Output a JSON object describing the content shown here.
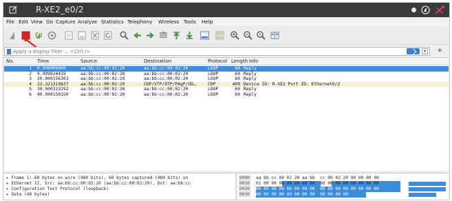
{
  "window": {
    "title": "R-XE2_e0/2"
  },
  "menu": [
    "File",
    "Edit",
    "View",
    "Go",
    "Capture",
    "Analyze",
    "Statistics",
    "Telephony",
    "Wireless",
    "Tools",
    "Help"
  ],
  "toolbar": {
    "icons": [
      "shark-fin-start-icon",
      "stop-capture-icon",
      "restart-capture-icon",
      "capture-options-icon",
      "open-file-icon",
      "save-file-icon",
      "close-file-icon",
      "reload-icon",
      "find-packet-icon",
      "go-back-icon",
      "go-forward-icon",
      "go-to-packet-icon",
      "go-first-icon",
      "go-last-icon",
      "autoscroll-icon",
      "colorize-icon",
      "zoom-in-icon",
      "zoom-out-icon",
      "zoom-normal-icon",
      "resize-columns-icon"
    ]
  },
  "filter": {
    "placeholder": "Apply a display filter ... <Ctrl-/>"
  },
  "columns": [
    "No.",
    "Time",
    "Source",
    "Destination",
    "Protocol",
    "Length",
    "Info"
  ],
  "packets": [
    {
      "no": "1",
      "time": "0.000000000",
      "src": "aa:bb:cc:00:02:20",
      "dst": "aa:bb:cc:00:02:20",
      "proto": "LOOP",
      "len": "60",
      "info": "Reply",
      "state": "selected"
    },
    {
      "no": "2",
      "time": "9.999024419",
      "src": "aa:bb:cc:00:02:20",
      "dst": "aa:bb:cc:00:02:20",
      "proto": "LOOP",
      "len": "60",
      "info": "Reply",
      "state": ""
    },
    {
      "no": "3",
      "time": "20.000156303",
      "src": "aa:bb:cc:00:02:20",
      "dst": "aa:bb:cc:00:02:20",
      "proto": "LOOP",
      "len": "60",
      "info": "Reply",
      "state": ""
    },
    {
      "no": "4",
      "time": "22.321319837",
      "src": "aa:bb:cc:00:02:20",
      "dst": "CDP/VTP/DTP/PAgP/UD…",
      "proto": "CDP",
      "len": "409",
      "info": "Device ID: R-XE2  Port ID: Ethernet0/2",
      "state": "highlight"
    },
    {
      "no": "5",
      "time": "30.000323292",
      "src": "aa:bb:cc:00:02:20",
      "dst": "aa:bb:cc:00:02:20",
      "proto": "LOOP",
      "len": "60",
      "info": "Reply",
      "state": ""
    },
    {
      "no": "6",
      "time": "40.000150150",
      "src": "aa:bb:cc:00:02:20",
      "dst": "aa:bb:cc:00:02:20",
      "proto": "LOOP",
      "len": "60",
      "info": "Reply",
      "state": ""
    }
  ],
  "details": [
    "Frame 1: 60 bytes on wire (480 bits), 60 bytes captured (480 bits) on",
    "Ethernet II, Src: aa:bb:cc:00:02:20 (aa:bb:cc:00:02:20), Dst: aa:bb:cc",
    "Configuration Test Protocol (loopback)",
    "Data (40 bytes)"
  ],
  "bytes": [
    {
      "offset": "0000",
      "hex": "aa bb cc 00 02 20 aa bb  cc 00 02 20 90 00 00 00"
    },
    {
      "offset": "0010",
      "hex": "01 00 00 00 00 00 00 00  00 00 00 00 00 00 00 00"
    },
    {
      "offset": "0020",
      "hex": "00 00 00 00 00 00 00 00  00 00 00 00 00 00 00 00"
    },
    {
      "offset": "0030",
      "hex": "00 00 00 00 00 00 00 00  00 00 00 00"
    }
  ],
  "colors": {
    "selected_row": "#3d8bd9",
    "cdp_row": "#fbf0d2",
    "titlebar": "#3a3a3a",
    "stop_button": "#e01f1f",
    "annotation_arrow": "#e02020"
  }
}
